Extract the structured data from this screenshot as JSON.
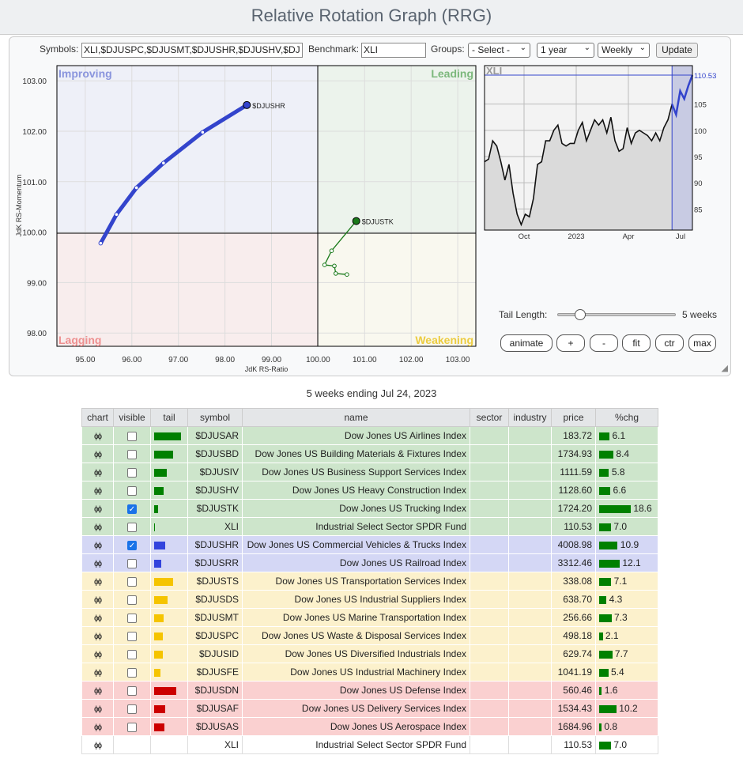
{
  "title": "Relative Rotation Graph (RRG)",
  "controls": {
    "symbols_label": "Symbols:",
    "symbols_value": "XLI,$DJUSPC,$DJUSMT,$DJUSHR,$DJUSHV,$DJ",
    "benchmark_label": "Benchmark:",
    "benchmark_value": "XLI",
    "groups_label": "Groups:",
    "groups_value": "- Select -",
    "period_value": "1 year",
    "interval_value": "Weekly",
    "update_label": "Update"
  },
  "rrg": {
    "quadrants": {
      "improving": "Improving",
      "leading": "Leading",
      "lagging": "Lagging",
      "weakening": "Weakening"
    },
    "xlabel": "JdK RS-Ratio",
    "ylabel": "JdK RS-Momentum",
    "xticks": [
      "95.00",
      "96.00",
      "97.00",
      "98.00",
      "99.00",
      "100.00",
      "101.00",
      "102.00",
      "103.00"
    ],
    "yticks": [
      "98.00",
      "99.00",
      "100.00",
      "101.00",
      "102.00",
      "103.00"
    ],
    "series": [
      {
        "name": "$DJUSHR",
        "color": "#3344cc",
        "points": [
          [
            95.33,
            99.78
          ],
          [
            95.67,
            100.35
          ],
          [
            96.1,
            100.88
          ],
          [
            96.68,
            101.37
          ],
          [
            97.52,
            101.98
          ],
          [
            98.47,
            102.52
          ]
        ]
      },
      {
        "name": "$DJUSTK",
        "color": "#1a7a1a",
        "points": [
          [
            100.62,
            99.16
          ],
          [
            100.38,
            99.18
          ],
          [
            100.35,
            99.33
          ],
          [
            100.14,
            99.35
          ],
          [
            100.29,
            99.63
          ],
          [
            100.82,
            100.22
          ]
        ]
      }
    ]
  },
  "price_chart": {
    "symbol": "XLI",
    "last_label": "110.53",
    "yticks": [
      "105",
      "100",
      "95",
      "90",
      "85"
    ],
    "xticks": [
      "Oct",
      "2023",
      "Apr",
      "Jul"
    ],
    "values": [
      94,
      94.5,
      98,
      97,
      94,
      90.5,
      93.5,
      88,
      84,
      82,
      84,
      83.5,
      87,
      93.5,
      94,
      98,
      98,
      100,
      101,
      97.5,
      97,
      97.5,
      97.5,
      100,
      101.5,
      98,
      100,
      102,
      101,
      102,
      99.5,
      102.5,
      98,
      96,
      96.5,
      100.5,
      97.5,
      99.5,
      100,
      99.5,
      99,
      98,
      99.5,
      98,
      100.5,
      102,
      105,
      103,
      107.5,
      106,
      108.5,
      110.53
    ],
    "tail_weeks": 5
  },
  "tail": {
    "label": "Tail Length:",
    "value_label": "5 weeks",
    "fraction": 0.1
  },
  "buttons": {
    "animate": "animate",
    "plus": "+",
    "minus": "-",
    "fit": "fit",
    "ctr": "ctr",
    "max": "max"
  },
  "table_title": "5 weeks ending Jul 24, 2023",
  "columns": [
    "chart",
    "visible",
    "tail",
    "symbol",
    "name",
    "sector",
    "industry",
    "price",
    "%chg"
  ],
  "rows": [
    {
      "cls": "g",
      "tc": "#008000",
      "tail": 1.0,
      "checked": false,
      "symbol": "$DJUSAR",
      "name": "Dow Jones US Airlines Index",
      "price": "183.72",
      "chg": "6.1"
    },
    {
      "cls": "g",
      "tc": "#008000",
      "tail": 0.7,
      "checked": false,
      "symbol": "$DJUSBD",
      "name": "Dow Jones US Building Materials & Fixtures Index",
      "price": "1734.93",
      "chg": "8.4"
    },
    {
      "cls": "g",
      "tc": "#008000",
      "tail": 0.47,
      "checked": false,
      "symbol": "$DJUSIV",
      "name": "Dow Jones US Business Support Services Index",
      "price": "1111.59",
      "chg": "5.8"
    },
    {
      "cls": "g",
      "tc": "#008000",
      "tail": 0.35,
      "checked": false,
      "symbol": "$DJUSHV",
      "name": "Dow Jones US Heavy Construction Index",
      "price": "1128.60",
      "chg": "6.6"
    },
    {
      "cls": "g",
      "tc": "#008000",
      "tail": 0.15,
      "checked": true,
      "symbol": "$DJUSTK",
      "name": "Dow Jones US Trucking Index",
      "price": "1724.20",
      "chg": "18.6"
    },
    {
      "cls": "g",
      "tc": "#008000",
      "tail": 0.03,
      "checked": false,
      "symbol": "XLI",
      "name": "Industrial Select Sector SPDR Fund",
      "price": "110.53",
      "chg": "7.0"
    },
    {
      "cls": "b",
      "tc": "#3344dd",
      "tail": 0.4,
      "checked": true,
      "symbol": "$DJUSHR",
      "name": "Dow Jones US Commercial Vehicles & Trucks Index",
      "price": "4008.98",
      "chg": "10.9"
    },
    {
      "cls": "b",
      "tc": "#3344dd",
      "tail": 0.26,
      "checked": false,
      "symbol": "$DJUSRR",
      "name": "Dow Jones US Railroad Index",
      "price": "3312.46",
      "chg": "12.1"
    },
    {
      "cls": "y",
      "tc": "#f5c400",
      "tail": 0.7,
      "checked": false,
      "symbol": "$DJUSTS",
      "name": "Dow Jones US Transportation Services Index",
      "price": "338.08",
      "chg": "7.1"
    },
    {
      "cls": "y",
      "tc": "#f5c400",
      "tail": 0.5,
      "checked": false,
      "symbol": "$DJUSDS",
      "name": "Dow Jones US Industrial Suppliers Index",
      "price": "638.70",
      "chg": "4.3"
    },
    {
      "cls": "y",
      "tc": "#f5c400",
      "tail": 0.35,
      "checked": false,
      "symbol": "$DJUSMT",
      "name": "Dow Jones US Marine Transportation Index",
      "price": "256.66",
      "chg": "7.3"
    },
    {
      "cls": "y",
      "tc": "#f5c400",
      "tail": 0.32,
      "checked": false,
      "symbol": "$DJUSPC",
      "name": "Dow Jones US Waste & Disposal Services Index",
      "price": "498.18",
      "chg": "2.1"
    },
    {
      "cls": "y",
      "tc": "#f5c400",
      "tail": 0.32,
      "checked": false,
      "symbol": "$DJUSID",
      "name": "Dow Jones US Diversified Industrials Index",
      "price": "629.74",
      "chg": "7.7"
    },
    {
      "cls": "y",
      "tc": "#f5c400",
      "tail": 0.24,
      "checked": false,
      "symbol": "$DJUSFE",
      "name": "Dow Jones US Industrial Machinery Index",
      "price": "1041.19",
      "chg": "5.4"
    },
    {
      "cls": "r",
      "tc": "#cc0000",
      "tail": 0.82,
      "checked": false,
      "symbol": "$DJUSDN",
      "name": "Dow Jones US Defense Index",
      "price": "560.46",
      "chg": "1.6"
    },
    {
      "cls": "r",
      "tc": "#cc0000",
      "tail": 0.4,
      "checked": false,
      "symbol": "$DJUSAF",
      "name": "Dow Jones US Delivery Services Index",
      "price": "1534.43",
      "chg": "10.2"
    },
    {
      "cls": "r",
      "tc": "#cc0000",
      "tail": 0.38,
      "checked": false,
      "symbol": "$DJUSAS",
      "name": "Dow Jones US Aerospace Index",
      "price": "1684.96",
      "chg": "0.8"
    },
    {
      "cls": "w",
      "tc": "",
      "tail": 0,
      "checked": null,
      "symbol": "XLI",
      "name": "Industrial Select Sector SPDR Fund",
      "price": "110.53",
      "chg": "7.0"
    }
  ]
}
